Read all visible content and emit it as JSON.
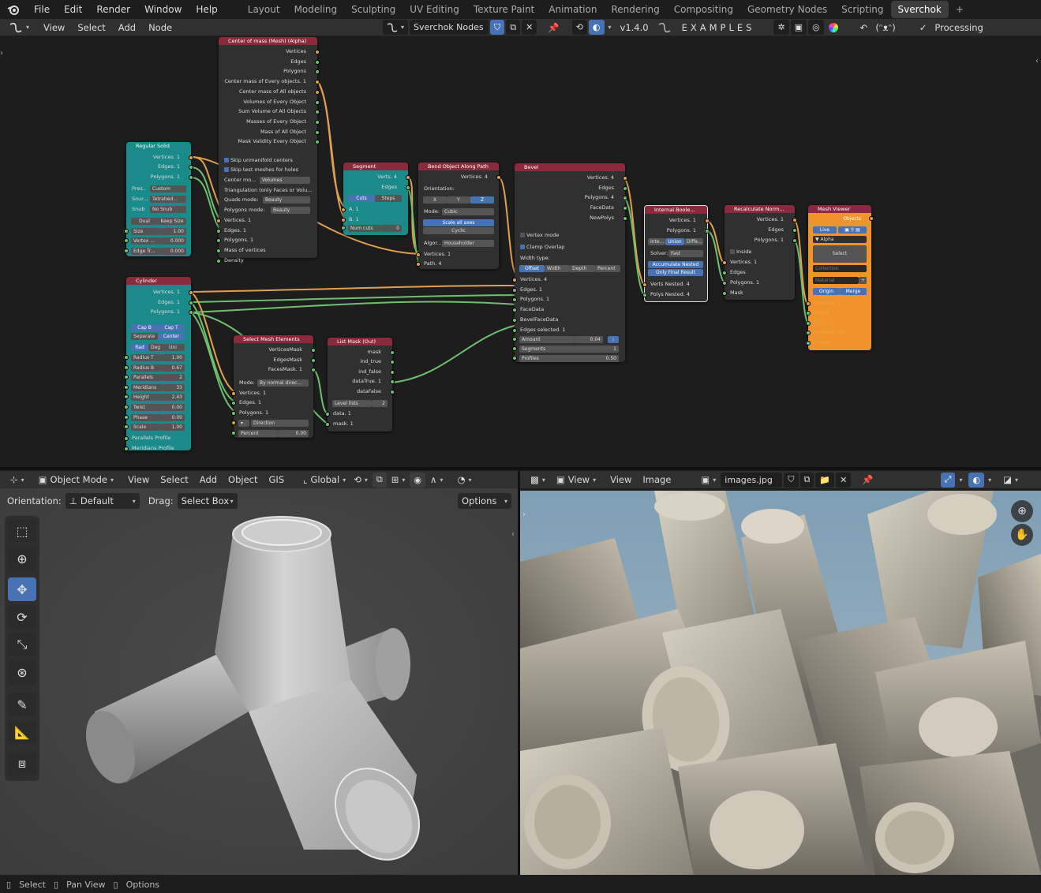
{
  "topbar": {
    "menus": [
      "File",
      "Edit",
      "Render",
      "Window",
      "Help"
    ],
    "workspaces": [
      "Layout",
      "Modeling",
      "Sculpting",
      "UV Editing",
      "Texture Paint",
      "Animation",
      "Rendering",
      "Compositing",
      "Geometry Nodes",
      "Scripting",
      "Sverchok"
    ],
    "active_workspace": "Sverchok",
    "add_tab": "+"
  },
  "node_header": {
    "menus": [
      "View",
      "Select",
      "Add",
      "Node"
    ],
    "tree_name": "Sverchok Nodes",
    "version": "v1.4.0",
    "examples": "EXAMPLES",
    "face": "(ᵔᴥᵔ)",
    "processing_label": "Processing",
    "processing_checked": true
  },
  "nodes": {
    "regular_solid": {
      "title": "Regular Solid",
      "outputs": [
        "Vertices. 1",
        "Edges. 1",
        "Polygons. 1"
      ],
      "preset_label": "Pres..",
      "preset": "Custom",
      "source_label": "Sour...",
      "source": "Tetrahed...",
      "snub_label": "Snub",
      "snub": "No Snub",
      "dual": "Dual",
      "keep_size": "Keep Size",
      "size_label": "Size",
      "size": "1.00",
      "vertex_label": "Vertex ...",
      "vertex": "0.000",
      "edge_label": "Edge Tr...",
      "edge": "0.000"
    },
    "center_mass": {
      "title": "Center of mass (Mesh) (Alpha)",
      "outputs": [
        "Vertices",
        "Edges",
        "Polygons",
        "Center mass of Every objects. 1",
        "Center mass of All objects",
        "Volumes of Every Object",
        "Sum Volume of All Objects",
        "Masses of Every Object",
        "Mass of All Object",
        "Mask Validity Every Object"
      ],
      "chk1": "Skip unmanifold centers",
      "chk2": "Skip test meshes for holes",
      "center_label": "Center mo...",
      "center": "Volumes",
      "tri_label": "Triangulation (only Faces or Volu...",
      "quads_label": "Quads mode:",
      "quads": "Beauty",
      "poly_label": "Polygons mode:",
      "poly": "Beauty",
      "inputs": [
        "Vertices. 1",
        "Edges. 1",
        "Polygons. 1",
        "Mass of vertices",
        "Density"
      ]
    },
    "segment": {
      "title": "Segment",
      "outputs": [
        "Verts. 4",
        "Edges"
      ],
      "cuts": "Cuts",
      "steps": "Steps",
      "inputs": [
        "A. 1",
        "B. 1"
      ],
      "num_cuts_label": "Num cuts",
      "num_cuts": "0"
    },
    "bend": {
      "title": "Bend Object Along Path",
      "outputs": [
        "Vertices. 4"
      ],
      "orientation_label": "Orientation:",
      "x": "X",
      "y": "Y",
      "z": "Z",
      "mode_label": "Mode:",
      "mode": "Cubic",
      "scale_all": "Scale all axes",
      "cyclic": "Cyclic",
      "algo_label": "Algor...",
      "algo": "Householder",
      "inputs": [
        "Vertices. 1",
        "Path. 4"
      ]
    },
    "bevel": {
      "title": "Bevel",
      "outputs": [
        "Vertices. 4",
        "Edges",
        "Polygons. 4",
        "FaceData",
        "NewPolys"
      ],
      "vertex_mode": "Vertex mode",
      "clamp_overlap": "Clamp Overlap",
      "width_type_label": "Width type:",
      "offset": "Offset",
      "width": "Width",
      "depth": "Depth",
      "percent": "Percent",
      "inputs": [
        "Vertices. 4",
        "Edges. 1",
        "Polygons. 1",
        "FaceData",
        "BevelFaceData",
        "Edges selected. 1"
      ],
      "amount_label": "Amount",
      "amount": "0.04",
      "segments_label": "Segments",
      "segments": "1",
      "profiles_label": "Profiles",
      "profiles": "0.50"
    },
    "internal_boolean": {
      "title": "Internal Boole...",
      "outputs": [
        "Vertices. 1",
        "Polygons. 1"
      ],
      "inte": "Inte...",
      "union": "Union",
      "diffe": "Diffe...",
      "solver_label": "Solver:",
      "solver": "Fast",
      "accumulate": "Accumulate Nested",
      "only_final": "Only Final Result",
      "inputs": [
        "Verts Nested. 4",
        "Polys Nested. 4"
      ]
    },
    "recalc_normals": {
      "title": "Recalculate Norm...",
      "outputs": [
        "Vertices. 1",
        "Edges",
        "Polygons. 1"
      ],
      "inside": "Inside",
      "inputs": [
        "Vertices. 1",
        "Edges",
        "Polygons. 1",
        "Mask"
      ]
    },
    "mesh_viewer": {
      "title": "Mesh Viewer",
      "objects": "Objects",
      "live": "Live",
      "alpha": "Alpha",
      "select": "Select",
      "collection": "Collection",
      "material": "Material",
      "origin": "Origin",
      "merge": "Merge",
      "inputs": [
        "vertices. 1",
        "edges",
        "faces. 1",
        "material_idx",
        "matrix"
      ]
    },
    "cylinder": {
      "title": "Cylinder",
      "outputs": [
        "Vertices. 1",
        "Edges. 1",
        "Polygons. 1"
      ],
      "cap_b": "Cap B",
      "cap_t": "Cap T",
      "separate": "Separate",
      "center": "Center",
      "rad": "Rad",
      "deg": "Deg",
      "uni": "Uni",
      "fields": [
        [
          "Radius T",
          "1.00"
        ],
        [
          "Radius B",
          "0.67"
        ],
        [
          "Parallels",
          "2"
        ],
        [
          "Meridians",
          "33"
        ],
        [
          "Height",
          "2.43"
        ],
        [
          "Twist",
          "0.00"
        ],
        [
          "Phase",
          "0.00"
        ],
        [
          "Scale",
          "1.00"
        ]
      ],
      "inputs": [
        "Parallels Profile",
        "Meridians Profile"
      ]
    },
    "select_mesh": {
      "title": "Select Mesh Elements",
      "outputs": [
        "VerticesMask",
        "EdgesMask",
        "FacesMask. 1"
      ],
      "mode_label": "Mode:",
      "mode": "By normal direc...",
      "inputs": [
        "Vertices. 1",
        "Edges. 1",
        "Polygons. 1"
      ],
      "direction": "Direction",
      "percent_label": "Percent",
      "percent": "0.00"
    },
    "list_mask": {
      "title": "List Mask (Out)",
      "outputs": [
        "mask",
        "ind_true",
        "ind_false",
        "dataTrue. 1",
        "dataFalse"
      ],
      "level_label": "Level lists",
      "level": "2",
      "inputs": [
        "data. 1",
        "mask. 1"
      ]
    }
  },
  "viewport_header": {
    "mode": "Object Mode",
    "menus": [
      "View",
      "Select",
      "Add",
      "Object",
      "GIS"
    ],
    "transform": "Global",
    "orientation_label": "Orientation:",
    "orientation": "Default",
    "drag_label": "Drag:",
    "drag": "Select Box",
    "options": "Options"
  },
  "tools": [
    "select-box-icon",
    "cursor-icon",
    "move-icon",
    "rotate-icon",
    "scale-icon",
    "transform-icon",
    "annotate-icon",
    "measure-icon",
    "add-cube-icon"
  ],
  "image_header": {
    "menus": [
      "View",
      "View",
      "Image"
    ],
    "image_name": "images.jpg"
  },
  "status": {
    "select": "Select",
    "pan": "Pan View",
    "options": "Options"
  },
  "colors": {
    "accent": "#4772b3",
    "node_header_red": "#8a2a3a",
    "node_teal": "#1a8a8a",
    "node_orange": "#f0932a",
    "socket_green": "#6ec06e",
    "socket_orange": "#e0a050"
  }
}
